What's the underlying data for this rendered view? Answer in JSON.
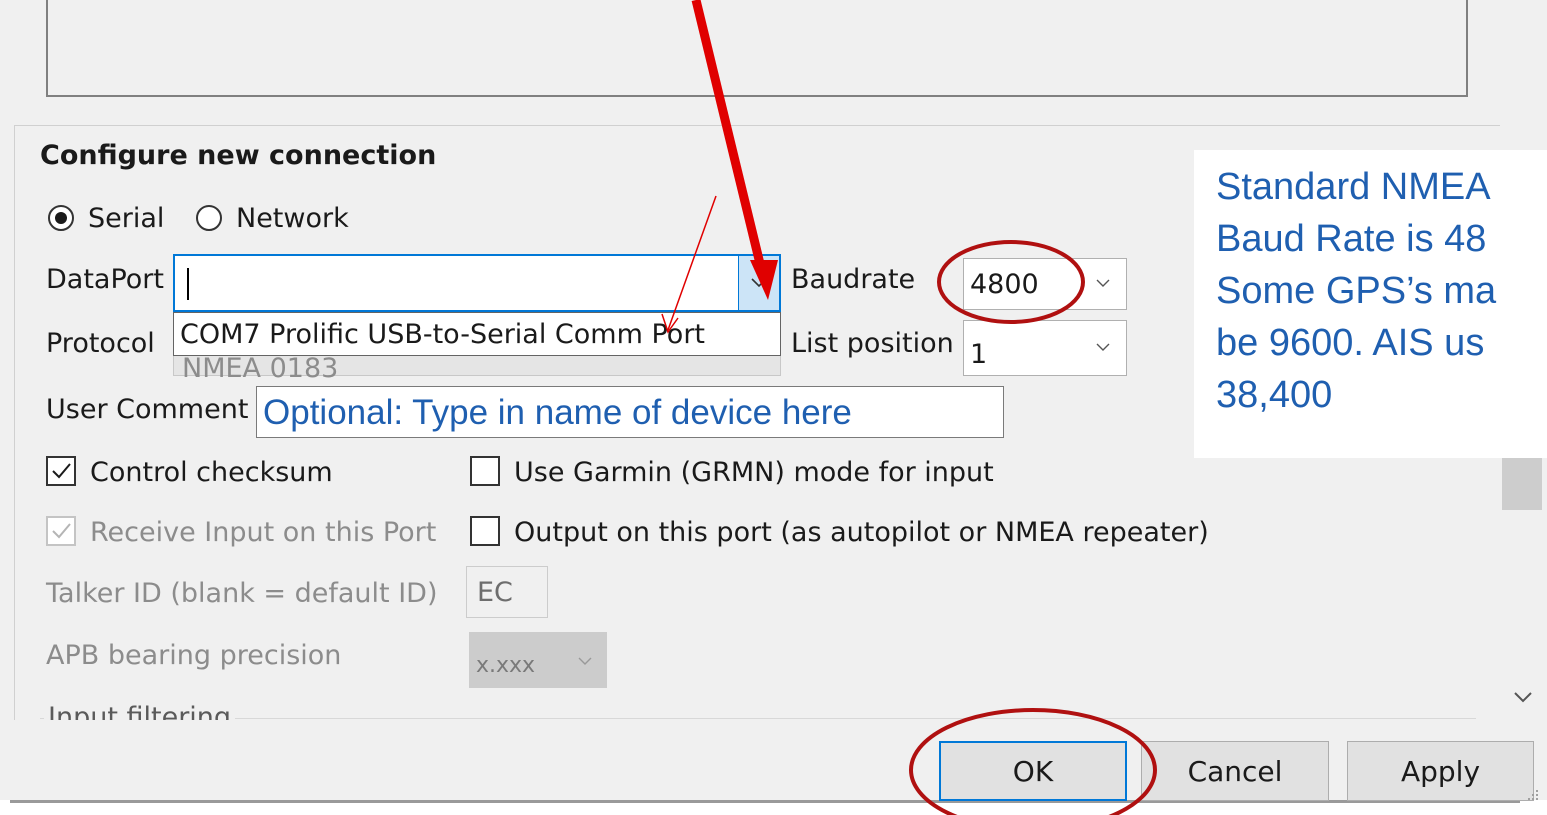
{
  "section_title": "Configure new connection",
  "conn_type": {
    "serial": "Serial",
    "network": "Network",
    "selected": "serial"
  },
  "dataport": {
    "label": "DataPort",
    "value": "",
    "dropdown_option": "COM7 Prolific USB-to-Serial Comm Port"
  },
  "baudrate": {
    "label": "Baudrate",
    "value": "4800"
  },
  "protocol": {
    "label": "Protocol",
    "value": "NMEA 0183"
  },
  "list_position": {
    "label": "List position",
    "value": "1"
  },
  "user_comment": {
    "label": "User Comment",
    "placeholder": "Optional: Type in name of device here"
  },
  "checks": {
    "control_checksum": "Control checksum",
    "garmin_mode": "Use Garmin (GRMN) mode for input",
    "receive_input": "Receive Input on this Port",
    "output_port": "Output on this port (as autopilot or NMEA repeater)"
  },
  "talker": {
    "label": "Talker ID (blank = default ID)",
    "value": "EC"
  },
  "apb": {
    "label": "APB bearing precision",
    "value": "x.xxx"
  },
  "input_filtering": "Input filtering",
  "buttons": {
    "ok": "OK",
    "cancel": "Cancel",
    "apply": "Apply"
  },
  "annotation": {
    "lines": [
      "Standard NMEA",
      "Baud Rate is 48",
      "Some GPS’s ma",
      "be 9600. AIS us",
      "38,400"
    ],
    "color": "#1f5fb0"
  },
  "colors": {
    "arrow": "#e00000",
    "circle": "#b01010",
    "accent": "#0078d7"
  },
  "icons": {
    "dropdown": "chevron-down-icon",
    "scroll_down": "chevron-down-icon",
    "check": "check-icon"
  }
}
